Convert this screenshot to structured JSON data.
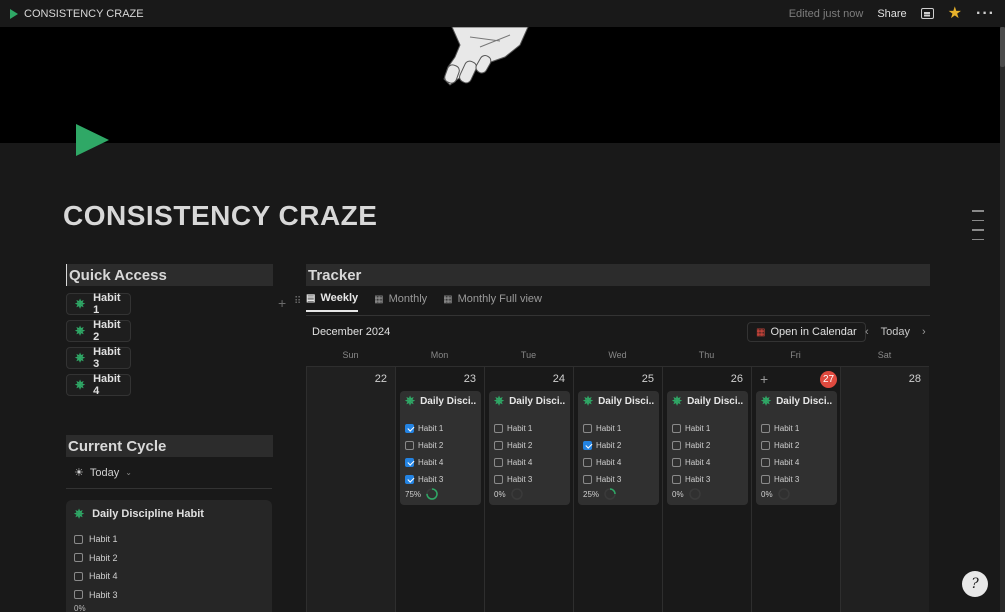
{
  "topbar": {
    "title": "CONSISTENCY CRAZE",
    "edited": "Edited just now",
    "share": "Share"
  },
  "page": {
    "title": "CONSISTENCY CRAZE",
    "icon": "green-play-triangle",
    "accent_color": "#2fa866"
  },
  "quick_access": {
    "heading": "Quick Access",
    "items": [
      "Habit 1",
      "Habit 2",
      "Habit 3",
      "Habit 4"
    ]
  },
  "current_cycle": {
    "heading": "Current Cycle",
    "filter": "Today",
    "card": {
      "title": "Daily Discipline Habit",
      "habits": [
        "Habit 1",
        "Habit 2",
        "Habit 4",
        "Habit 3"
      ],
      "percent": "0%"
    }
  },
  "tracker": {
    "heading": "Tracker",
    "tabs": [
      "Weekly",
      "Monthly",
      "Monthly Full view"
    ],
    "month": "December 2024",
    "open_calendar": "Open in Calendar",
    "today": "Today",
    "weekdays": [
      "Sun",
      "Mon",
      "Tue",
      "Wed",
      "Thu",
      "Fri",
      "Sat"
    ],
    "days": [
      {
        "num": "22",
        "card": null
      },
      {
        "num": "23",
        "card": {
          "title": "Daily Disci...",
          "habits": [
            {
              "label": "Habit 1",
              "checked": true
            },
            {
              "label": "Habit 2",
              "checked": false
            },
            {
              "label": "Habit 4",
              "checked": true
            },
            {
              "label": "Habit 3",
              "checked": true
            }
          ],
          "percent": "75%",
          "progress": 0.75
        }
      },
      {
        "num": "24",
        "card": {
          "title": "Daily Disci...",
          "habits": [
            {
              "label": "Habit 1",
              "checked": false
            },
            {
              "label": "Habit 2",
              "checked": false
            },
            {
              "label": "Habit 4",
              "checked": false
            },
            {
              "label": "Habit 3",
              "checked": false
            }
          ],
          "percent": "0%",
          "progress": 0
        }
      },
      {
        "num": "25",
        "card": {
          "title": "Daily Disci...",
          "habits": [
            {
              "label": "Habit 1",
              "checked": false
            },
            {
              "label": "Habit 2",
              "checked": true
            },
            {
              "label": "Habit 4",
              "checked": false
            },
            {
              "label": "Habit 3",
              "checked": false
            }
          ],
          "percent": "25%",
          "progress": 0.25
        }
      },
      {
        "num": "26",
        "card": {
          "title": "Daily Disci...",
          "habits": [
            {
              "label": "Habit 1",
              "checked": false
            },
            {
              "label": "Habit 2",
              "checked": false
            },
            {
              "label": "Habit 4",
              "checked": false
            },
            {
              "label": "Habit 3",
              "checked": false
            }
          ],
          "percent": "0%",
          "progress": 0
        }
      },
      {
        "num": "27",
        "today": true,
        "card": {
          "title": "Daily Disci...",
          "habits": [
            {
              "label": "Habit 1",
              "checked": false
            },
            {
              "label": "Habit 2",
              "checked": false
            },
            {
              "label": "Habit 4",
              "checked": false
            },
            {
              "label": "Habit 3",
              "checked": false
            }
          ],
          "percent": "0%",
          "progress": 0
        }
      },
      {
        "num": "28",
        "card": null
      }
    ],
    "today_color": "#e04a3f",
    "check_color": "#2383e2"
  },
  "help": {
    "glyph": "?"
  }
}
